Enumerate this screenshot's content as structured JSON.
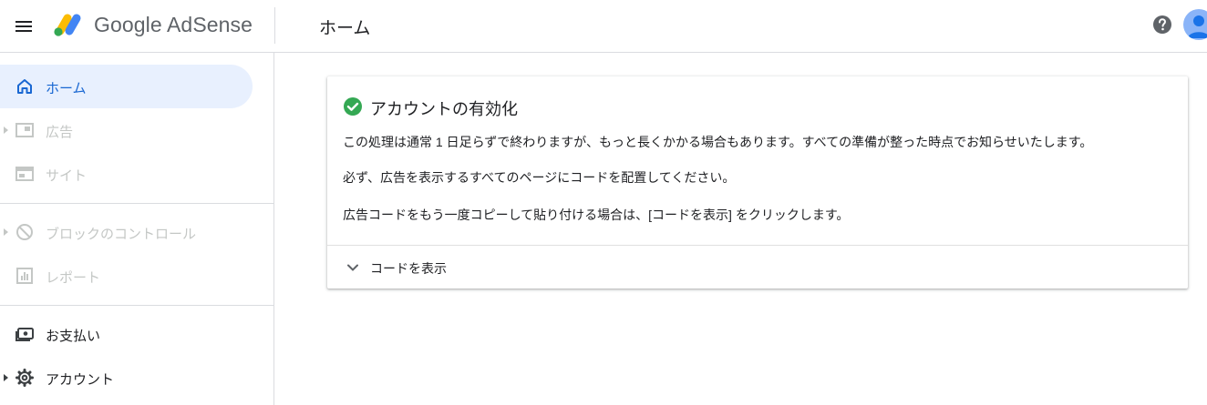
{
  "header": {
    "brand": "Google AdSense",
    "page_title": "ホーム",
    "icons": {
      "menu": "hamburger-icon",
      "logo": "adsense-logo-icon",
      "help": "help-icon",
      "account": "avatar"
    }
  },
  "sidebar": {
    "items": [
      {
        "label": "ホーム",
        "icon": "home-icon",
        "state": "active"
      },
      {
        "label": "広告",
        "icon": "ads-icon",
        "state": "disabled"
      },
      {
        "label": "サイト",
        "icon": "sites-icon",
        "state": "disabled"
      },
      {
        "label": "ブロックのコントロール",
        "icon": "block-icon",
        "state": "disabled"
      },
      {
        "label": "レポート",
        "icon": "reports-icon",
        "state": "disabled"
      },
      {
        "label": "お支払い",
        "icon": "payments-icon",
        "state": "enabled"
      },
      {
        "label": "アカウント",
        "icon": "gear-icon",
        "state": "enabled"
      }
    ]
  },
  "card": {
    "title": "アカウントの有効化",
    "paragraphs": [
      "この処理は通常 1 日足らずで終わりますが、もっと長くかかる場合もあります。すべての準備が整った時点でお知らせいたします。",
      "必ず、広告を表示するすべてのページにコードを配置してください。",
      "広告コードをもう一度コピーして貼り付ける場合は、[コードを表示] をクリックします。"
    ],
    "expand_label": "コードを表示"
  },
  "colors": {
    "accent": "#1a73e8",
    "active_bg": "#e8f0fe",
    "success": "#34a853",
    "disabled": "#c4c7c5"
  }
}
